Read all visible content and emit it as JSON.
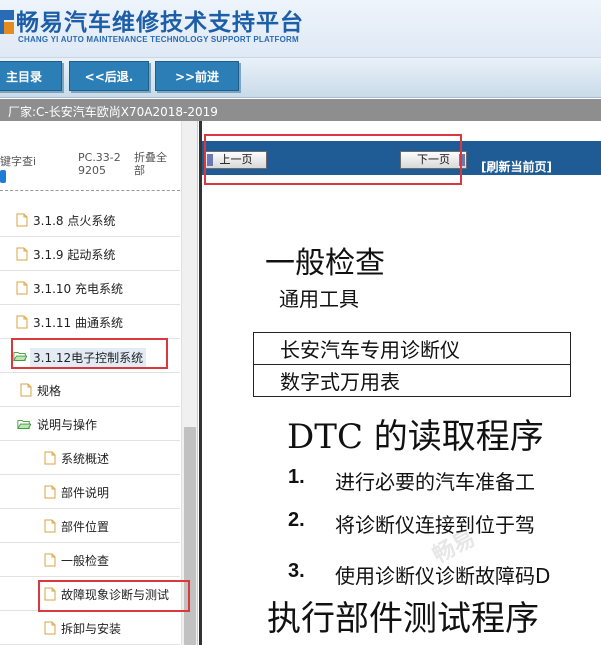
{
  "app": {
    "title_cn": "畅易汽车维修技术支持平台",
    "title_en": "CHANG YI AUTO MAINTENANCE TECHNOLOGY SUPPORT PLATFORM"
  },
  "nav": {
    "main_menu": "主目录",
    "back": "<<后退.",
    "forward": ">>前进"
  },
  "maker": {
    "label": "厂家:C-长安汽车欧尚X70A2018-2019"
  },
  "sidebar": {
    "tabs": [
      {
        "label": "键字查i"
      },
      {
        "label": "PC.33-29205"
      },
      {
        "label": "折叠全部"
      }
    ],
    "tree": [
      {
        "label": "3.1.8 点火系统",
        "icon": "file-icon"
      },
      {
        "label": "3.1.9 起动系统",
        "icon": "file-icon"
      },
      {
        "label": "3.1.10 充电系统",
        "icon": "file-icon"
      },
      {
        "label": "3.1.11 曲通系统",
        "icon": "file-icon"
      },
      {
        "label": "3.1.12电子控制系统",
        "icon": "folder-open-icon"
      },
      {
        "label": "规格",
        "icon": "file-icon"
      },
      {
        "label": "说明与操作",
        "icon": "folder-open-icon"
      },
      {
        "label": "系统概述",
        "icon": "file-icon"
      },
      {
        "label": "部件说明",
        "icon": "file-icon"
      },
      {
        "label": "部件位置",
        "icon": "file-icon"
      },
      {
        "label": "一般检查",
        "icon": "file-icon"
      },
      {
        "label": "故障现象诊断与测试",
        "icon": "file-icon"
      },
      {
        "label": "拆卸与安装",
        "icon": "file-icon"
      }
    ]
  },
  "content": {
    "prev_page": "上一页",
    "next_page": "下一页",
    "refresh": "[刷新当前页]",
    "heading": "一般检查",
    "subheading": "通用工具",
    "tools": [
      "长安汽车专用诊断仪",
      "数字式万用表"
    ],
    "dtc_heading": "DTC 的读取程序",
    "steps": [
      {
        "num": "1.",
        "text": "进行必要的汽车准备工"
      },
      {
        "num": "2.",
        "text": "将诊断仪连接到位于驾"
      },
      {
        "num": "3.",
        "text": "使用诊断仪诊断故障码D"
      }
    ],
    "actuator_heading": "执行部件测试程序",
    "watermark": "畅易"
  }
}
